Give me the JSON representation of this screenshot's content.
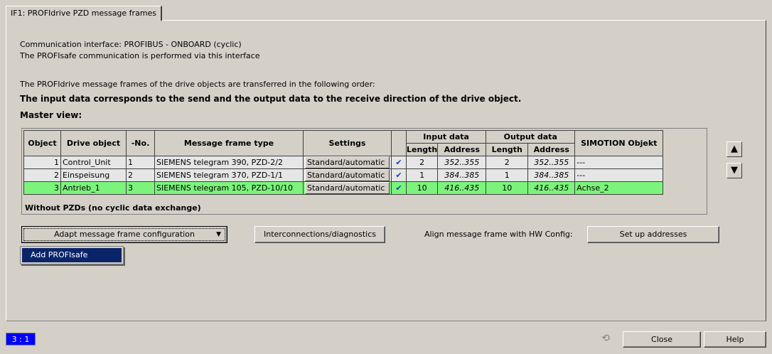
{
  "tab": {
    "label": "IF1:  PROFIdrive  PZD message frames"
  },
  "info": {
    "line1": "Communication interface: PROFIBUS - ONBOARD (cyclic)",
    "line2": "The PROFIsafe communication is performed via this interface",
    "line3": "The PROFIdrive message frames of the drive objects are transferred in the following order:",
    "line4": "The input data corresponds to the send and the output data to the receive direction of the drive object.",
    "master_view": "Master view:"
  },
  "table": {
    "headers": {
      "object": "Object",
      "drive_object": "Drive object",
      "no": "-No.",
      "frame_type": "Message frame type",
      "settings": "Settings",
      "input_data": "Input data",
      "output_data": "Output data",
      "simotion": "SIMOTION Objekt",
      "length": "Length",
      "address": "Address"
    },
    "rows": [
      {
        "object": "1",
        "drive_object": "Control_Unit",
        "no": "1",
        "frame_type": "SIEMENS telegram 390, PZD-2/2",
        "settings": "Standard/automatic",
        "check": "✔",
        "in_len": "2",
        "in_addr": "352..355",
        "out_len": "2",
        "out_addr": "352..355",
        "simotion": "---"
      },
      {
        "object": "2",
        "drive_object": "Einspeisung",
        "no": "2",
        "frame_type": "SIEMENS telegram 370, PZD-1/1",
        "settings": "Standard/automatic",
        "check": "✔",
        "in_len": "1",
        "in_addr": "384..385",
        "out_len": "1",
        "out_addr": "384..385",
        "simotion": "---"
      },
      {
        "object": "3",
        "drive_object": "Antrieb_1",
        "no": "3",
        "frame_type": "SIEMENS telegram 105, PZD-10/10",
        "settings": "Standard/automatic",
        "check": "✔",
        "in_len": "10",
        "in_addr": "416..435",
        "out_len": "10",
        "out_addr": "416..435",
        "simotion": "Achse_2"
      }
    ],
    "footer": "Without PZDs (no cyclic data exchange)",
    "selected_row_color": "#7cf47c"
  },
  "buttons": {
    "adapt": "Adapt message frame configuration",
    "interconnections": "Interconnections/diagnostics",
    "align_label": "Align message frame with HW Config:",
    "setup_addresses": "Set up addresses",
    "close": "Close",
    "help": "Help"
  },
  "menu": {
    "item": "Add PROFIsafe"
  },
  "status": {
    "position": "3 : 1",
    "color": "#0000ff"
  },
  "icons": {
    "up": "up-arrow-icon",
    "down": "down-arrow-icon",
    "dropdown": "dropdown-arrow-icon",
    "refresh": "refresh-icon"
  }
}
